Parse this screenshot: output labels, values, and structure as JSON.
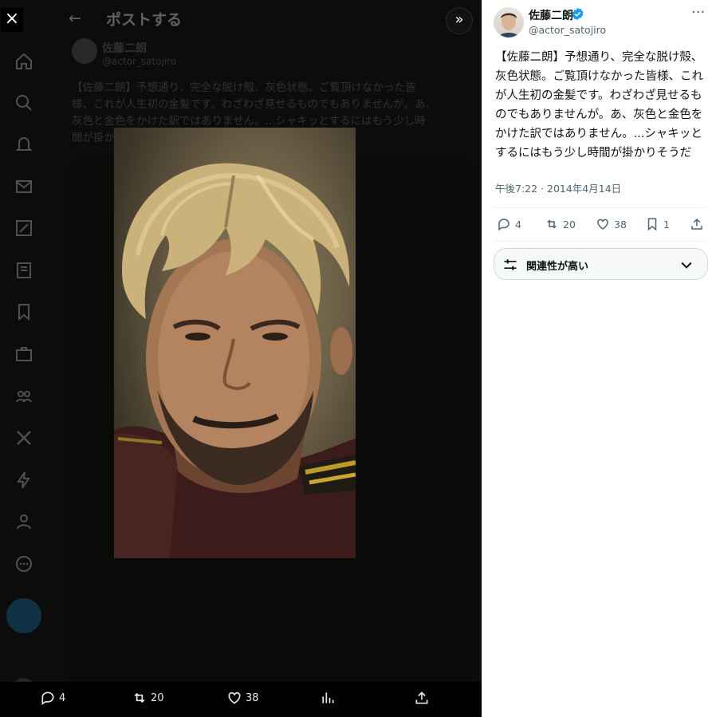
{
  "viewer": {
    "back_label": "←",
    "header_title": "ポストする",
    "close_label": "×",
    "expand_label": "»"
  },
  "background_post": {
    "author": "佐藤二朗",
    "handle": "@actor_satojiro",
    "text_lines": [
      "【佐藤二朗】予想通り、完全な脱け殻、灰色状態。ご覧頂けなかった皆",
      "様、これが人生初の金髪です。わざわざ見せるものでもありませんが。あ、",
      "灰色と金色をかけた訳ではありません。...シャキッとするにはもう少し時",
      "間が掛かりそうだ"
    ]
  },
  "bottom_bar": {
    "replies": "4",
    "reposts": "20",
    "likes": "38"
  },
  "tweet": {
    "author_name": "佐藤二朗",
    "handle": "@actor_satojiro",
    "text": "【佐藤二朗】予想通り、完全な脱け殻、灰色状態。ご覧頂けなかった皆様、これが人生初の金髪です。わざわざ見せるものでもありませんが。あ、灰色と金色をかけた訳ではありません。...シャキッとするにはもう少し時間が掛かりそうだ",
    "timestamp": "午後7:22 · 2014年4月14日",
    "replies": "4",
    "reposts": "20",
    "likes": "38",
    "bookmarks": "1",
    "more_label": "···"
  },
  "relevance_dropdown": {
    "label": "関連性が高い"
  },
  "colors": {
    "verified_blue": "#1d9bf0",
    "text_primary": "#0f1419",
    "text_secondary": "#536471"
  }
}
